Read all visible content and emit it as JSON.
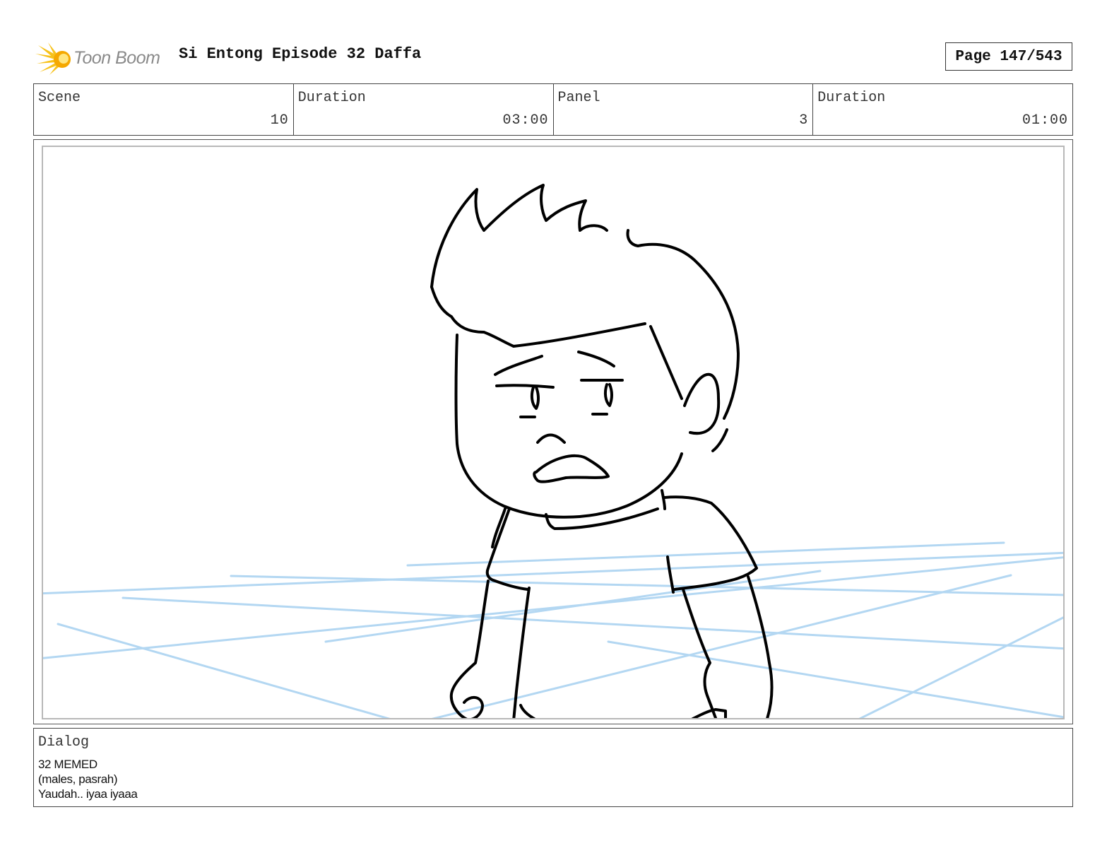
{
  "header": {
    "logo_text": "Toon Boom",
    "title": "Si Entong Episode 32 Daffa",
    "page": "Page 147/543"
  },
  "info": [
    {
      "label": "Scene",
      "value": "10"
    },
    {
      "label": "Duration",
      "value": "03:00"
    },
    {
      "label": "Panel",
      "value": "3"
    },
    {
      "label": "Duration",
      "value": "01:00"
    }
  ],
  "panel": {
    "sketch_color": "#000000",
    "guide_color": "#b3d7f2"
  },
  "dialog": {
    "label": "Dialog",
    "lines": [
      "32 MEMED",
      "(males, pasrah)",
      "Yaudah.. iyaa iyaaa"
    ]
  },
  "colors": {
    "logo_accent": "#f7c21a",
    "border": "#444444"
  }
}
